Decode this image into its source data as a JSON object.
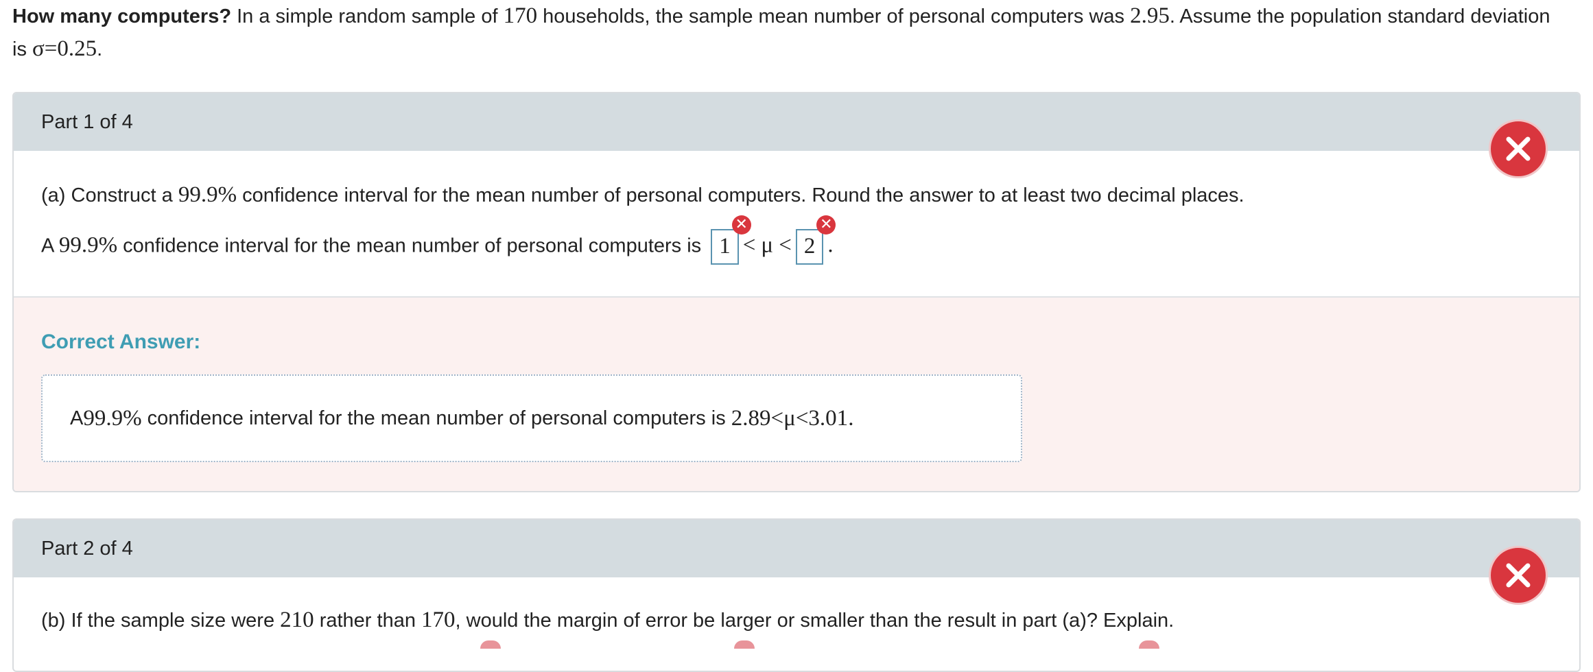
{
  "intro": {
    "title": "How many computers?",
    "text1": " In a simple random sample of ",
    "n": "170",
    "text2": " households, the sample mean number of personal computers was ",
    "mean": "2.95",
    "text3": ". Assume the population standard deviation is ",
    "sigma": "σ=0.25",
    "text4": "."
  },
  "part1": {
    "header": "Part 1 of 4",
    "question_prefix": "(a) Construct a ",
    "question_pct": "99.9%",
    "question_suffix": " confidence interval for the mean number of personal computers. Round the answer to at least two decimal places.",
    "response_prefix": "A ",
    "response_pct": "99.9%",
    "response_text": " confidence interval for the mean number of personal computers is ",
    "lower_value": "1",
    "less_than_1": "<",
    "mu": "μ",
    "less_than_2": "<",
    "upper_value": "2",
    "period": ".",
    "correct_label": "Correct Answer:",
    "correct_prefix": "A ",
    "correct_pct": "99.9%",
    "correct_text": " confidence interval for the mean number of personal computers is ",
    "correct_math": "2.89<μ<3.01",
    "correct_period": "."
  },
  "part2": {
    "header": "Part 2 of 4",
    "question_a": "(b) If the sample size were ",
    "question_n1": "210",
    "question_b": " rather than ",
    "question_n2": "170",
    "question_c": ", would the margin of error be larger or smaller than the result in part (a)? Explain."
  },
  "colors": {
    "incorrect": "#d9363e",
    "accent": "#3f9db3",
    "header_bg": "#d4dce0",
    "correct_bg": "#fcf1f0"
  },
  "icons": {
    "wrong": "close-icon"
  }
}
